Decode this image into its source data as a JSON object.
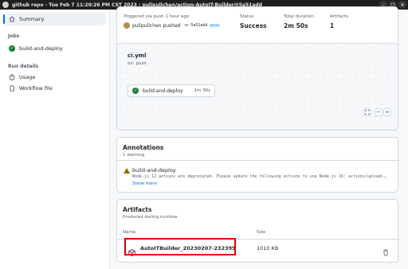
{
  "window": {
    "title": "github repo - Tue Feb 7 11:20:26 PM CST 2023 - pulipulichen/action-AutoIT-Builder@5a51add"
  },
  "sidebar": {
    "summary_label": "Summary",
    "jobs_heading": "Jobs",
    "job_label": "build-and-deploy",
    "run_details_heading": "Run details",
    "usage_label": "Usage",
    "workflow_file_label": "Workflow file"
  },
  "run_info": {
    "trigger_label": "Triggered via push 1 hour ago",
    "user": "pulipulichen",
    "action": "pushed",
    "commit": "5a51add",
    "branch": "main",
    "status_label": "Status",
    "status_value": "Success",
    "duration_label": "Total duration",
    "duration_value": "2m 50s",
    "artifacts_label": "Artifacts",
    "artifacts_value": "1"
  },
  "workflow": {
    "file": "ci.yml",
    "trigger": "on: push",
    "job_name": "build-and-deploy",
    "job_time": "1m 36s",
    "zoom_minus": "−",
    "zoom_plus": "+"
  },
  "annotations": {
    "title": "Annotations",
    "count": "1 warning",
    "item_title": "build-and-deploy",
    "item_message": "Node.js 12 actions are deprecated. Please update the following actions to use Node.js 16: actions/upload-…",
    "show_more": "Show more"
  },
  "artifacts": {
    "title": "Artifacts",
    "subtitle": "Produced during runtime",
    "col_name": "Name",
    "col_size": "Size",
    "rows": [
      {
        "name": "AutoITBuilder_20230207-232399",
        "size": "1010 KB"
      }
    ]
  },
  "colors": {
    "success": "#1a7f37",
    "accent": "#0969da",
    "warning": "#9a6700",
    "highlight": "#e00000"
  }
}
